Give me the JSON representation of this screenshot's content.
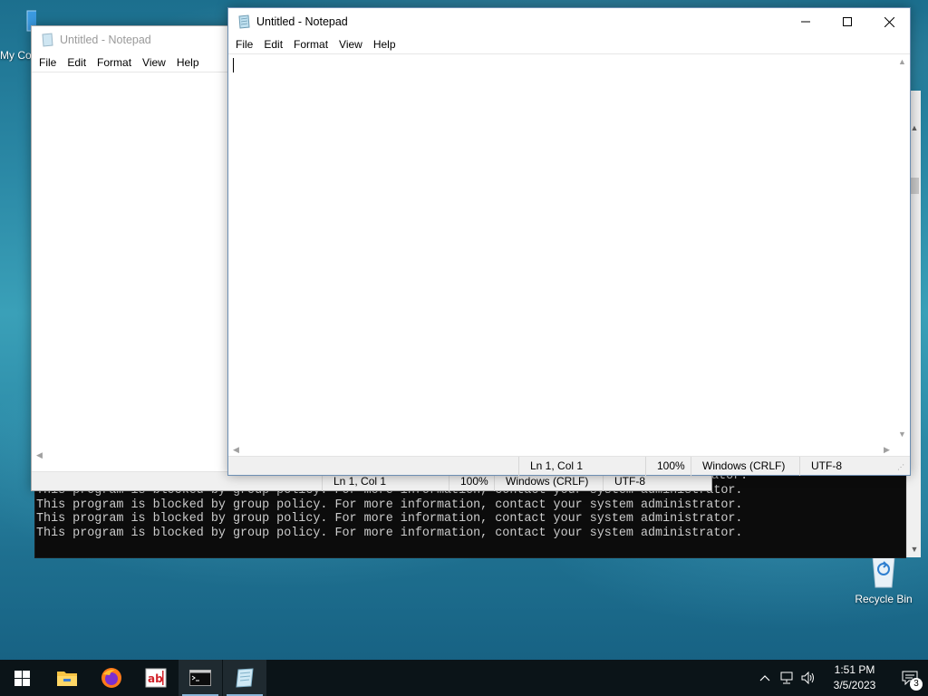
{
  "desktop": {
    "mypc_label": "My Co",
    "recycle_label": "Recycle Bin"
  },
  "console": {
    "lines": [
      "This program is blocked by group policy. For more information, contact your system administrator.",
      "This program is blocked by group policy. For more information, contact your system administrator.",
      "This program is blocked by group policy. For more information, contact your system administrator.",
      "This program is blocked by group policy. For more information, contact your system administrator."
    ],
    "partial_text": "ator."
  },
  "notepad_back": {
    "title": "Untitled - Notepad",
    "menu": [
      "File",
      "Edit",
      "Format",
      "View",
      "Help"
    ],
    "status": {
      "position": "Ln 1, Col 1",
      "zoom": "100%",
      "line_ending": "Windows (CRLF)",
      "encoding": "UTF-8"
    }
  },
  "notepad_front": {
    "title": "Untitled - Notepad",
    "menu": [
      "File",
      "Edit",
      "Format",
      "View",
      "Help"
    ],
    "content": "",
    "status": {
      "position": "Ln 1, Col 1",
      "zoom": "100%",
      "line_ending": "Windows (CRLF)",
      "encoding": "UTF-8"
    }
  },
  "taskbar": {
    "clock_time": "1:51 PM",
    "clock_date": "3/5/2023",
    "notification_count": "3",
    "pinned": [
      "start-icon",
      "file-explorer-icon",
      "firefox-icon",
      "abiword-icon",
      "terminal-icon",
      "notepad-icon"
    ]
  },
  "colors": {
    "taskbar": "#0b1418",
    "console_bg": "#0c0c0c",
    "console_text": "#cccccc",
    "accent": "#0078d7"
  }
}
